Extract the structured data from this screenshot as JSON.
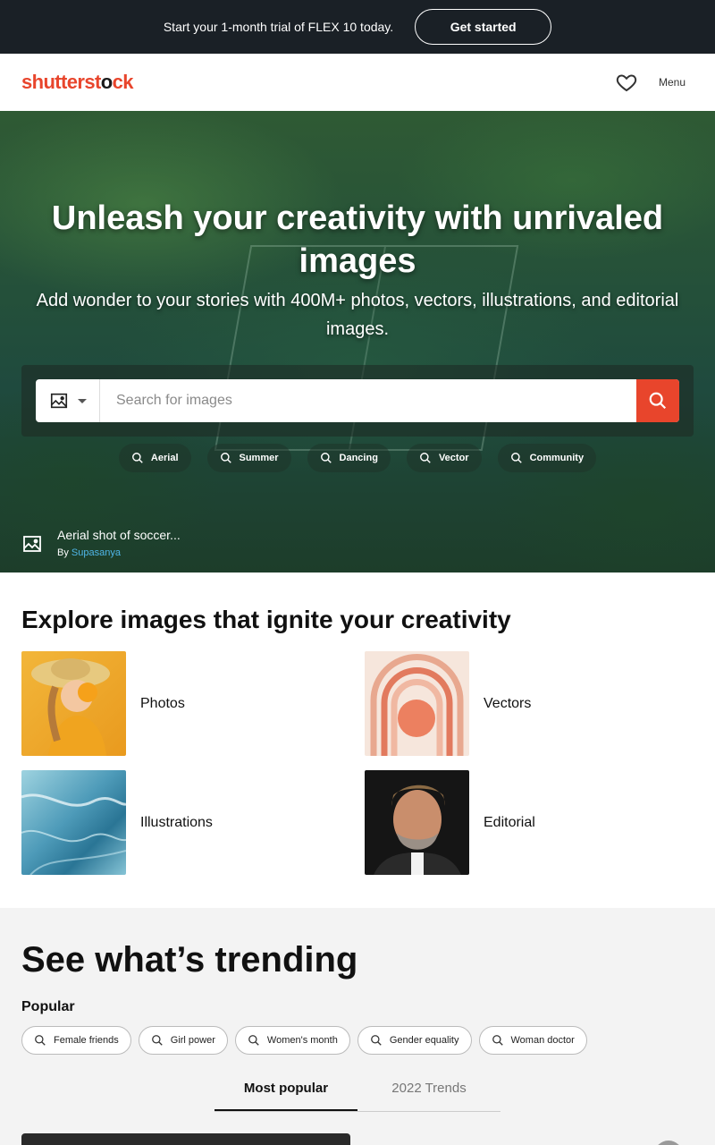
{
  "promo": {
    "text": "Start your 1-month trial of FLEX 10 today.",
    "button": "Get started"
  },
  "header": {
    "logo_red": "shutterst",
    "logo_mid": "o",
    "logo_dark": "ck",
    "menu_label": "Menu"
  },
  "hero": {
    "title": "Unleash your creativity with unrivaled images",
    "subtitle": "Add wonder to your stories with 400M+ photos, vectors, illustrations, and editorial images.",
    "search_placeholder": "Search for images",
    "chips": [
      "Aerial",
      "Summer",
      "Dancing",
      "Vector",
      "Community"
    ],
    "credit_title": "Aerial shot of soccer...",
    "credit_by": "By",
    "credit_author": "Supasanya"
  },
  "explore": {
    "title": "Explore images that ignite your creativity",
    "categories": [
      "Photos",
      "Vectors",
      "Illustrations",
      "Editorial"
    ]
  },
  "trending": {
    "title": "See what’s trending",
    "popular_label": "Popular",
    "chips": [
      "Female friends",
      "Girl power",
      "Women's month",
      "Gender equality",
      "Woman doctor"
    ],
    "tabs": [
      "Most popular",
      "2022 Trends"
    ]
  },
  "colors": {
    "brand": "#e8452c",
    "promo_bg": "#1a2026",
    "link": "#4fb6e8"
  }
}
